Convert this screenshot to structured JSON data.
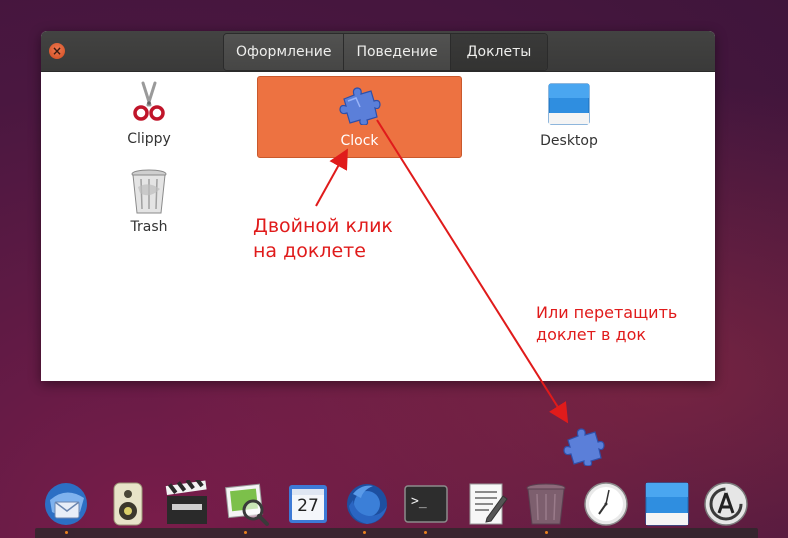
{
  "window": {
    "close_symbol": "×",
    "tabs": [
      {
        "label": "Оформление",
        "active": false
      },
      {
        "label": "Поведение",
        "active": false
      },
      {
        "label": "Доклеты",
        "active": true
      }
    ]
  },
  "applets": [
    {
      "name": "Clippy",
      "icon": "scissors-icon"
    },
    {
      "name": "Clock",
      "icon": "puzzle-icon",
      "selected": true
    },
    {
      "name": "Desktop",
      "icon": "desktop-icon"
    },
    {
      "name": "Trash",
      "icon": "trash-icon"
    }
  ],
  "annotations": {
    "double_click": "Двойной клик\nна доклете",
    "drag": "Или перетащить\nдоклет в док"
  },
  "dock": {
    "items": [
      {
        "icon": "thunderbird-icon"
      },
      {
        "icon": "speaker-icon"
      },
      {
        "icon": "clapperboard-icon"
      },
      {
        "icon": "image-viewer-icon"
      },
      {
        "icon": "calendar-icon",
        "text": "27"
      },
      {
        "icon": "firefox-icon"
      },
      {
        "icon": "terminal-icon",
        "text": ">_"
      },
      {
        "icon": "text-editor-icon"
      },
      {
        "icon": "trash-icon"
      },
      {
        "icon": "clock-icon"
      },
      {
        "icon": "desktop-icon"
      },
      {
        "icon": "software-updater-icon"
      }
    ]
  },
  "colors": {
    "selection": "#ed7241",
    "annotation": "#e01b1b",
    "titlebar": "#3c3c3b"
  }
}
